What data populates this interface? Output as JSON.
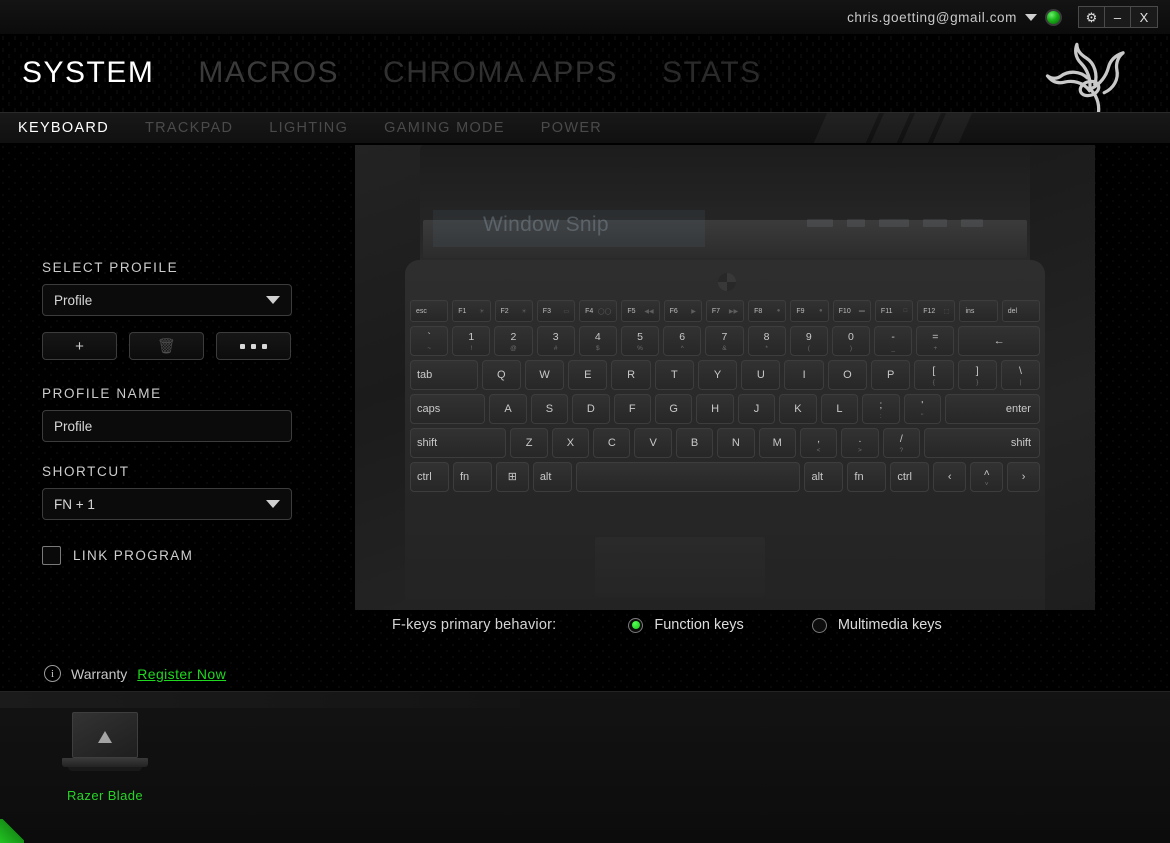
{
  "titlebar": {
    "email": "chris.goetting@gmail.com",
    "account_caret_icon": "chevron-down-icon",
    "status_icon": "online-status-orb",
    "settings_label": "⚙",
    "minimize_label": "–",
    "close_label": "X"
  },
  "main_tabs": [
    {
      "label": "SYSTEM",
      "active": true
    },
    {
      "label": "MACROS",
      "active": false
    },
    {
      "label": "CHROMA APPS",
      "active": false
    },
    {
      "label": "STATS",
      "active": false
    }
  ],
  "sub_tabs": [
    {
      "label": "KEYBOARD",
      "active": true
    },
    {
      "label": "TRACKPAD",
      "active": false
    },
    {
      "label": "LIGHTING",
      "active": false
    },
    {
      "label": "GAMING MODE",
      "active": false
    },
    {
      "label": "POWER",
      "active": false
    }
  ],
  "logo": {
    "name": "razer-logo"
  },
  "sidebar": {
    "select_profile_label": "SELECT PROFILE",
    "select_profile_value": "Profile",
    "add_profile_label": "+",
    "delete_profile_label": "🗑",
    "more_options_label": "•••",
    "profile_name_label": "PROFILE NAME",
    "profile_name_value": "Profile",
    "shortcut_label": "SHORTCUT",
    "shortcut_value": "FN + 1",
    "link_program_label": "LINK PROGRAM",
    "link_program_checked": false,
    "warranty_label": "Warranty",
    "warranty_info_icon": "info-icon",
    "register_link": "Register Now"
  },
  "device_panel": {
    "snip_overlay_text": "Window Snip"
  },
  "keyboard": {
    "function_row": [
      {
        "main": "esc",
        "sub": ""
      },
      {
        "main": "F1",
        "sub": "☀"
      },
      {
        "main": "F2",
        "sub": "☀"
      },
      {
        "main": "F3",
        "sub": "▭"
      },
      {
        "main": "F4",
        "sub": "◯◯"
      },
      {
        "main": "F5",
        "sub": "◀◀"
      },
      {
        "main": "F6",
        "sub": "▶"
      },
      {
        "main": "F7",
        "sub": "▶▶"
      },
      {
        "main": "F8",
        "sub": "●"
      },
      {
        "main": "F9",
        "sub": "●"
      },
      {
        "main": "F10",
        "sub": "▬"
      },
      {
        "main": "F11",
        "sub": "□"
      },
      {
        "main": "F12",
        "sub": "⬚"
      },
      {
        "main": "ins",
        "sub": ""
      },
      {
        "main": "del",
        "sub": ""
      }
    ],
    "number_row": [
      {
        "main": "`",
        "sub": "~"
      },
      {
        "main": "1",
        "sub": "!"
      },
      {
        "main": "2",
        "sub": "@"
      },
      {
        "main": "3",
        "sub": "#"
      },
      {
        "main": "4",
        "sub": "$"
      },
      {
        "main": "5",
        "sub": "%"
      },
      {
        "main": "6",
        "sub": "^"
      },
      {
        "main": "7",
        "sub": "&"
      },
      {
        "main": "8",
        "sub": "*"
      },
      {
        "main": "9",
        "sub": "("
      },
      {
        "main": "0",
        "sub": ")"
      },
      {
        "main": "-",
        "sub": "_"
      },
      {
        "main": "=",
        "sub": "+"
      },
      {
        "main": "←",
        "sub": ""
      }
    ],
    "tab_row": [
      {
        "main": "tab",
        "sub": ""
      },
      {
        "main": "Q",
        "sub": ""
      },
      {
        "main": "W",
        "sub": ""
      },
      {
        "main": "E",
        "sub": ""
      },
      {
        "main": "R",
        "sub": ""
      },
      {
        "main": "T",
        "sub": ""
      },
      {
        "main": "Y",
        "sub": ""
      },
      {
        "main": "U",
        "sub": ""
      },
      {
        "main": "I",
        "sub": ""
      },
      {
        "main": "O",
        "sub": ""
      },
      {
        "main": "P",
        "sub": ""
      },
      {
        "main": "[",
        "sub": "{"
      },
      {
        "main": "]",
        "sub": "}"
      },
      {
        "main": "\\",
        "sub": "|"
      }
    ],
    "home_row": [
      {
        "main": "caps",
        "sub": ""
      },
      {
        "main": "A",
        "sub": ""
      },
      {
        "main": "S",
        "sub": ""
      },
      {
        "main": "D",
        "sub": ""
      },
      {
        "main": "F",
        "sub": ""
      },
      {
        "main": "G",
        "sub": ""
      },
      {
        "main": "H",
        "sub": ""
      },
      {
        "main": "J",
        "sub": ""
      },
      {
        "main": "K",
        "sub": ""
      },
      {
        "main": "L",
        "sub": ""
      },
      {
        "main": ";",
        "sub": ":"
      },
      {
        "main": "'",
        "sub": "\""
      },
      {
        "main": "enter",
        "sub": ""
      }
    ],
    "shift_row": [
      {
        "main": "shift",
        "sub": ""
      },
      {
        "main": "Z",
        "sub": ""
      },
      {
        "main": "X",
        "sub": ""
      },
      {
        "main": "C",
        "sub": ""
      },
      {
        "main": "V",
        "sub": ""
      },
      {
        "main": "B",
        "sub": ""
      },
      {
        "main": "N",
        "sub": ""
      },
      {
        "main": "M",
        "sub": ""
      },
      {
        "main": ",",
        "sub": "<"
      },
      {
        "main": ".",
        "sub": ">"
      },
      {
        "main": "/",
        "sub": "?"
      },
      {
        "main": "shift",
        "sub": ""
      }
    ],
    "modifier_row": [
      {
        "main": "ctrl",
        "sub": ""
      },
      {
        "main": "fn",
        "sub": ""
      },
      {
        "main": "⊞",
        "sub": ""
      },
      {
        "main": "alt",
        "sub": ""
      },
      {
        "main": "",
        "sub": ""
      },
      {
        "main": "alt",
        "sub": ""
      },
      {
        "main": "fn",
        "sub": ""
      },
      {
        "main": "ctrl",
        "sub": ""
      },
      {
        "main": "‹",
        "sub": ""
      },
      {
        "main": "˄",
        "sub": "˅"
      },
      {
        "main": "›",
        "sub": ""
      }
    ]
  },
  "fkeys": {
    "label": "F-keys primary behavior:",
    "options": [
      {
        "label": "Function keys",
        "selected": true
      },
      {
        "label": "Multimedia keys",
        "selected": false
      }
    ]
  },
  "footer": {
    "device_name": "Razer Blade",
    "device_thumb_icon": "laptop-icon"
  }
}
